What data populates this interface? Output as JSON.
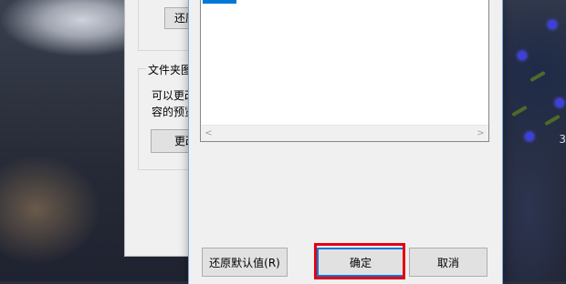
{
  "back_window": {
    "restore_button_label": "还原",
    "folder_group_legend": "文件夹图",
    "folder_desc_line1": "可以更改",
    "folder_desc_line2": "容的预览",
    "change_button_label": "更改"
  },
  "dialog": {
    "buttons": {
      "restore_defaults": "还原默认值(R)",
      "ok": "确定",
      "cancel": "取消"
    }
  },
  "desktop": {
    "edge_text": "3"
  },
  "colors": {
    "accent": "#0078d7",
    "highlight_box": "#e60012"
  }
}
